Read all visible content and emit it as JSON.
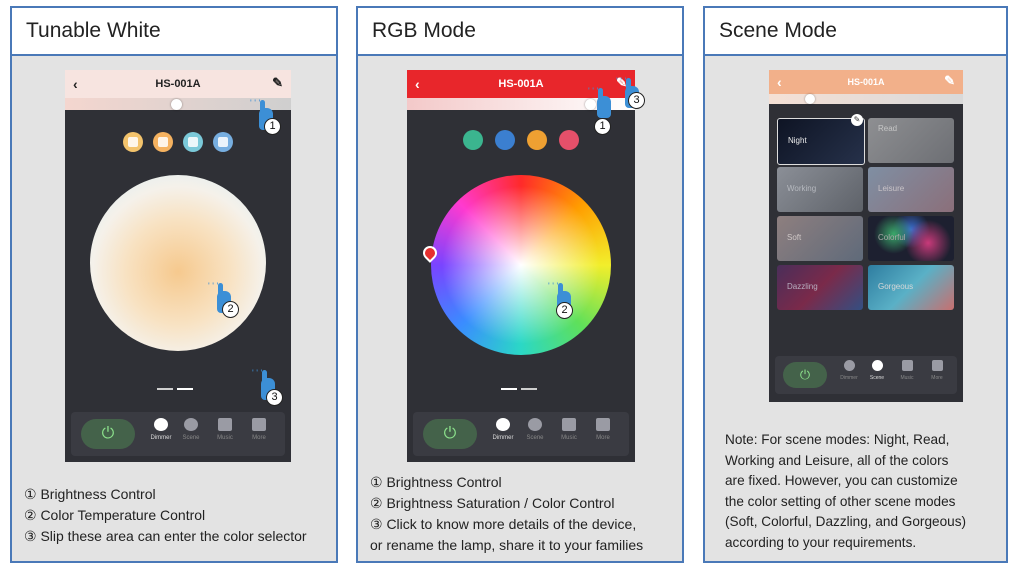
{
  "panels": [
    {
      "title": "Tunable White",
      "phone": {
        "device_name": "HS-001A"
      },
      "captions": [
        "① Brightness Control",
        "② Color Temperature Control",
        "③ Slip these area can enter the color selector"
      ]
    },
    {
      "title": "RGB Mode",
      "phone": {
        "device_name": "HS-001A"
      },
      "captions": [
        "① Brightness Control",
        "② Brightness Saturation / Color Control",
        "③ Click to know more details of the device,",
        "or rename the lamp, share it to your families"
      ]
    },
    {
      "title": "Scene Mode",
      "phone": {
        "device_name": "HS-001A"
      },
      "scenes": [
        "Night",
        "Read",
        "Working",
        "Leisure",
        "Soft",
        "Colorful",
        "Dazzling",
        "Gorgeous"
      ],
      "note": [
        "Note: For scene modes: Night, Read,",
        "Working and Leisure, all of the colors",
        "are fixed. However, you can customize",
        "the color setting of other scene modes",
        "(Soft, Colorful, Dazzling, and Gorgeous)",
        "according to your requirements."
      ]
    }
  ],
  "nav": {
    "dimmer": "Dimmer",
    "scene": "Scene",
    "music": "Music",
    "more": "More"
  },
  "icons": {
    "back": "chevron-left-icon",
    "edit": "pencil-icon",
    "power": "power-icon"
  },
  "badges": [
    "1",
    "2",
    "3"
  ],
  "colors": {
    "border": "#4a79b8",
    "rgb_header": "#e8262b",
    "tw_header": "#f7e4e0",
    "scene_header": "#f2b08a",
    "pointer": "#3c8fd6"
  },
  "rgb_swatches": [
    "#3bb58f",
    "#3b7fd0",
    "#eea032",
    "#e5506a"
  ],
  "tw_swatches": [
    "#f3c36c",
    "#f5b260",
    "#7bc9d9",
    "#77aee0"
  ]
}
